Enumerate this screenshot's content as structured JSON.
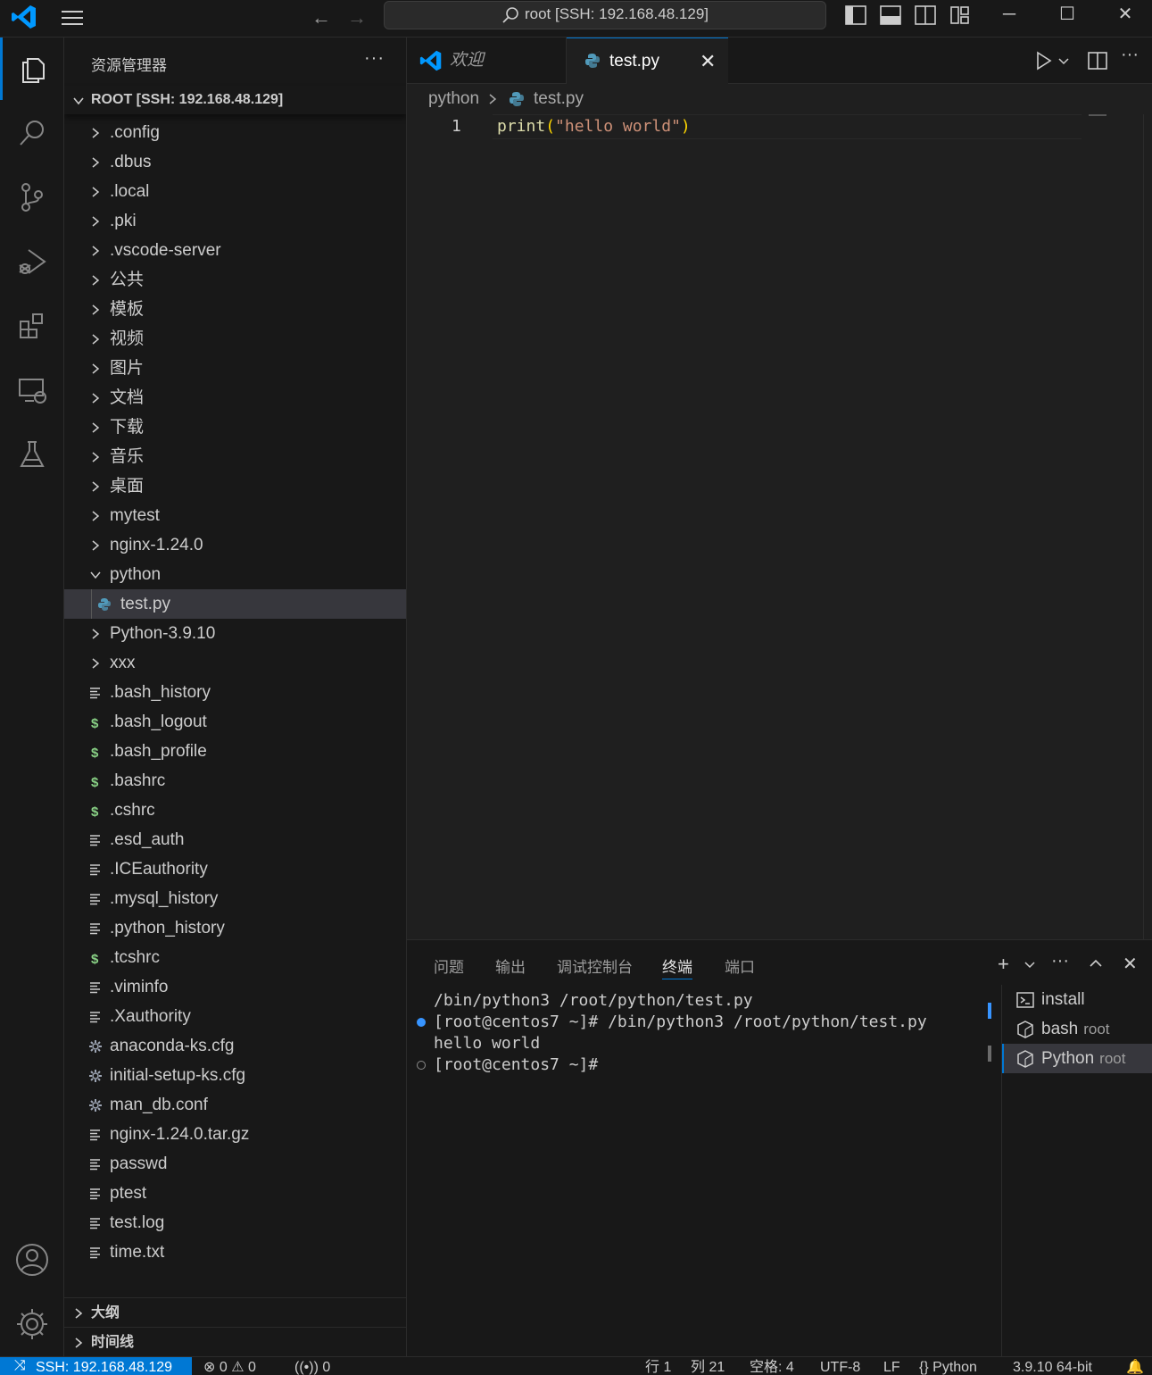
{
  "title_bar": {
    "search_text": "root [SSH: 192.168.48.129]"
  },
  "activity_bar": {
    "items": [
      "explorer-icon",
      "search-icon",
      "source-control-icon",
      "run-debug-icon",
      "extensions-icon",
      "remote-explorer-icon",
      "testing-icon"
    ],
    "bottom": [
      "account-icon",
      "manage-gear-icon"
    ]
  },
  "sidebar": {
    "title": "资源管理器",
    "more": "···",
    "root_label": "ROOT [SSH: 192.168.48.129]",
    "tree": [
      {
        "label": ".config",
        "kind": "folder"
      },
      {
        "label": ".dbus",
        "kind": "folder"
      },
      {
        "label": ".local",
        "kind": "folder"
      },
      {
        "label": ".pki",
        "kind": "folder"
      },
      {
        "label": ".vscode-server",
        "kind": "folder"
      },
      {
        "label": "公共",
        "kind": "folder"
      },
      {
        "label": "模板",
        "kind": "folder"
      },
      {
        "label": "视频",
        "kind": "folder"
      },
      {
        "label": "图片",
        "kind": "folder"
      },
      {
        "label": "文档",
        "kind": "folder"
      },
      {
        "label": "下载",
        "kind": "folder"
      },
      {
        "label": "音乐",
        "kind": "folder"
      },
      {
        "label": "桌面",
        "kind": "folder"
      },
      {
        "label": "mytest",
        "kind": "folder"
      },
      {
        "label": "nginx-1.24.0",
        "kind": "folder"
      },
      {
        "label": "python",
        "kind": "folder-open"
      },
      {
        "label": "test.py",
        "kind": "python",
        "selected": true
      },
      {
        "label": "Python-3.9.10",
        "kind": "folder"
      },
      {
        "label": "xxx",
        "kind": "folder"
      },
      {
        "label": ".bash_history",
        "kind": "text"
      },
      {
        "label": ".bash_logout",
        "kind": "shell"
      },
      {
        "label": ".bash_profile",
        "kind": "shell"
      },
      {
        "label": ".bashrc",
        "kind": "shell"
      },
      {
        "label": ".cshrc",
        "kind": "shell"
      },
      {
        "label": ".esd_auth",
        "kind": "text"
      },
      {
        "label": ".ICEauthority",
        "kind": "text"
      },
      {
        "label": ".mysql_history",
        "kind": "text"
      },
      {
        "label": ".python_history",
        "kind": "text"
      },
      {
        "label": ".tcshrc",
        "kind": "shell"
      },
      {
        "label": ".viminfo",
        "kind": "text"
      },
      {
        "label": ".Xauthority",
        "kind": "text"
      },
      {
        "label": "anaconda-ks.cfg",
        "kind": "config"
      },
      {
        "label": "initial-setup-ks.cfg",
        "kind": "config"
      },
      {
        "label": "man_db.conf",
        "kind": "config"
      },
      {
        "label": "nginx-1.24.0.tar.gz",
        "kind": "text"
      },
      {
        "label": "passwd",
        "kind": "text"
      },
      {
        "label": "ptest",
        "kind": "text"
      },
      {
        "label": "test.log",
        "kind": "text"
      },
      {
        "label": "time.txt",
        "kind": "text"
      }
    ],
    "outline_label": "大纲",
    "timeline_label": "时间线"
  },
  "tabs": [
    {
      "label": "欢迎",
      "active": false
    },
    {
      "label": "test.py",
      "active": true
    }
  ],
  "breadcrumb": {
    "folder": "python",
    "sep": ">",
    "file": "test.py"
  },
  "editor": {
    "line_number": "1",
    "code": {
      "fn": "print",
      "open": "(",
      "str": "\"hello world\"",
      "close": ")"
    }
  },
  "panel": {
    "tabs": [
      "问题",
      "输出",
      "调试控制台",
      "终端",
      "端口"
    ],
    "active_tab": "终端",
    "terminal_lines": [
      "/bin/python3 /root/python/test.py",
      "[root@centos7 ~]# /bin/python3 /root/python/test.py",
      "hello world",
      "[root@centos7 ~]#"
    ],
    "terminals": [
      {
        "name": "install",
        "sub": "",
        "icon": "terminal-icon"
      },
      {
        "name": "bash",
        "sub": "root",
        "icon": "bash-icon"
      },
      {
        "name": "Python",
        "sub": "root",
        "icon": "python-terminal-icon",
        "active": true
      }
    ]
  },
  "status_bar": {
    "remote": "SSH: 192.168.48.129",
    "errors": "0",
    "warnings": "0",
    "ports": "0",
    "line": "行 1",
    "col": "列 21",
    "spaces": "空格: 4",
    "encoding": "UTF-8",
    "eol": "LF",
    "language": "Python",
    "interpreter": "3.9.10 64-bit"
  },
  "colors": {
    "accent": "#0078d4",
    "background": "#1f1f1f",
    "sidebar": "#181818",
    "shell_icon": "#89d185",
    "python_icon": "#519aba"
  }
}
